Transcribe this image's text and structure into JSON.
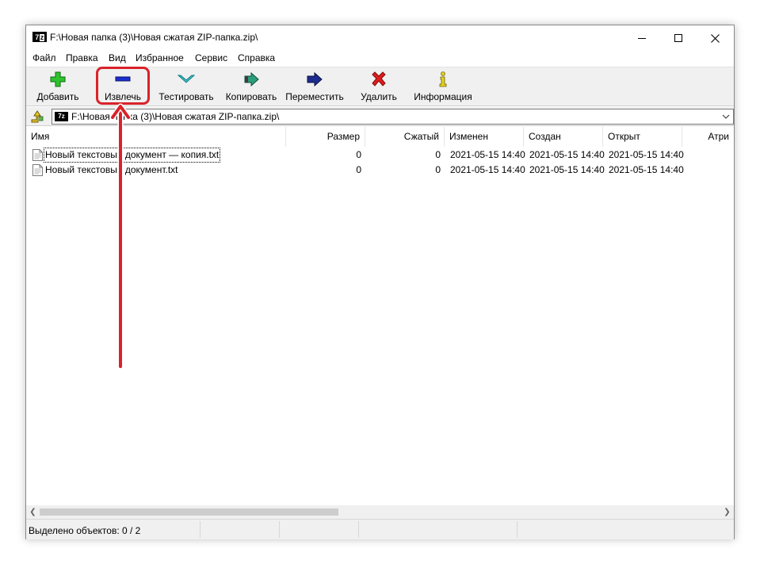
{
  "window": {
    "title": "F:\\Новая папка (3)\\Новая сжатая ZIP-папка.zip\\",
    "app_icon_text": "7z"
  },
  "menu": [
    {
      "label": "Файл"
    },
    {
      "label": "Правка"
    },
    {
      "label": "Вид"
    },
    {
      "label": "Избранное"
    },
    {
      "label": "Сервис"
    },
    {
      "label": "Справка"
    }
  ],
  "toolbar": {
    "add": "Добавить",
    "extract": "Извлечь",
    "test": "Тестировать",
    "copy": "Копировать",
    "move": "Переместить",
    "delete": "Удалить",
    "info": "Информация"
  },
  "address": {
    "path": "F:\\Новая папка (3)\\Новая сжатая ZIP-папка.zip\\"
  },
  "columns": {
    "name": "Имя",
    "size": "Размер",
    "packed": "Сжатый",
    "modified": "Изменен",
    "created": "Создан",
    "accessed": "Открыт",
    "attributes": "Атри"
  },
  "files": [
    {
      "name": "Новый текстовый документ — копия.txt",
      "size": "0",
      "packed": "0",
      "modified": "2021-05-15 14:40",
      "created": "2021-05-15 14:40",
      "accessed": "2021-05-15 14:40"
    },
    {
      "name": "Новый текстовый документ.txt",
      "size": "0",
      "packed": "0",
      "modified": "2021-05-15 14:40",
      "created": "2021-05-15 14:40",
      "accessed": "2021-05-15 14:40"
    }
  ],
  "status": {
    "selected": "Выделено объектов: 0 / 2"
  },
  "colors": {
    "highlight": "#d9222a",
    "toolbar_bg": "#f0f0f0"
  }
}
